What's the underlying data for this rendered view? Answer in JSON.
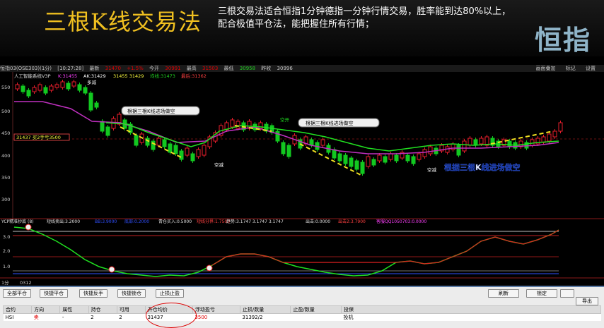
{
  "banner": {
    "title": "三根K线交易法",
    "desc_line1": "三根交易法适合恒指1分钟德指一分钟行情交易，胜率能到达80%以上，",
    "desc_line2": "配合极值平仓法，能把握住所有行情；",
    "logo": "恒指"
  },
  "topbar": {
    "items": [
      "恒指03(OSE303)(1分)",
      "[10:27:28]",
      "最新",
      "31470",
      "+1.5%",
      "今开",
      "30991",
      "最高",
      "31503",
      "最低",
      "30958",
      "昨收",
      "30996"
    ],
    "right": [
      "画面叠加",
      "标记",
      "设置"
    ]
  },
  "indicator_line": {
    "name": "人工智能系统V3P",
    "k": "K:31455",
    "ak": "AK:31429",
    "vals": "31455 31429",
    "jx": "均线:31473",
    "last": "最后:31362"
  },
  "price_axis": [
    "550",
    "500",
    "450",
    "400",
    "350",
    "300"
  ],
  "price_tag": "31437 买2手亏3500",
  "chart_labels": {
    "duo1": "多减",
    "kong1": "空减",
    "kong_kai": "空开",
    "kong2": "空减",
    "kong3": "空减"
  },
  "callouts": {
    "c1": "根据三根K线进场做空",
    "c2": "根据三根K线进场做空",
    "big": "根据三根K线进场做空"
  },
  "lower_indicator": {
    "name": "YCP精准抄底 (8)",
    "items": [
      {
        "label": "短线卖出:3.2000",
        "color": "#e0e0e0"
      },
      {
        "label": "BB:3.9000",
        "color": "#3050ff"
      },
      {
        "label": "底部:0.2000",
        "color": "#3050ff"
      },
      {
        "label": "青仓买入:0.5000",
        "color": "#e0e0e0"
      },
      {
        "label": "短线分界:1.7500",
        "color": "#ff4040"
      },
      {
        "label": "趋势:3.1747 3.1747 3.1747",
        "color": "#e0e0e0"
      },
      {
        "label": "出击:0.0000",
        "color": "#e0e0e0"
      },
      {
        "label": "出击2:3.7900",
        "color": "#ff4040"
      },
      {
        "label": "客服QQ1050703:0.0000",
        "color": "#ff40ff"
      }
    ],
    "axis": [
      "3.0",
      "2.0",
      "1.0"
    ]
  },
  "timebar": {
    "label1": "1分",
    "label2": "0312"
  },
  "buttons": {
    "close_all": "全部平仓",
    "quick_close": "快捷平仓",
    "quick_reverse": "快捷反手",
    "quick_lock": "快捷锁仓",
    "stop_loss": "止损止盈",
    "refresh": "刷新",
    "lock": "锁定",
    "export": "导出"
  },
  "table": {
    "headers": [
      "合约",
      "方向",
      "属性",
      "持仓",
      "可用",
      "开仓均价",
      "浮动盈亏",
      "止损/数量",
      "止盈/数量",
      "投保"
    ],
    "rows": [
      [
        "HSI",
        "卖",
        "-",
        "2",
        "2",
        "31437",
        "3500",
        "31392/2",
        "",
        "投机"
      ]
    ]
  },
  "colors": {
    "up": "#e81e2c",
    "down": "#12c820",
    "ma": "#20d020",
    "ma2": "#c030c0",
    "accent": "#f0c020"
  }
}
